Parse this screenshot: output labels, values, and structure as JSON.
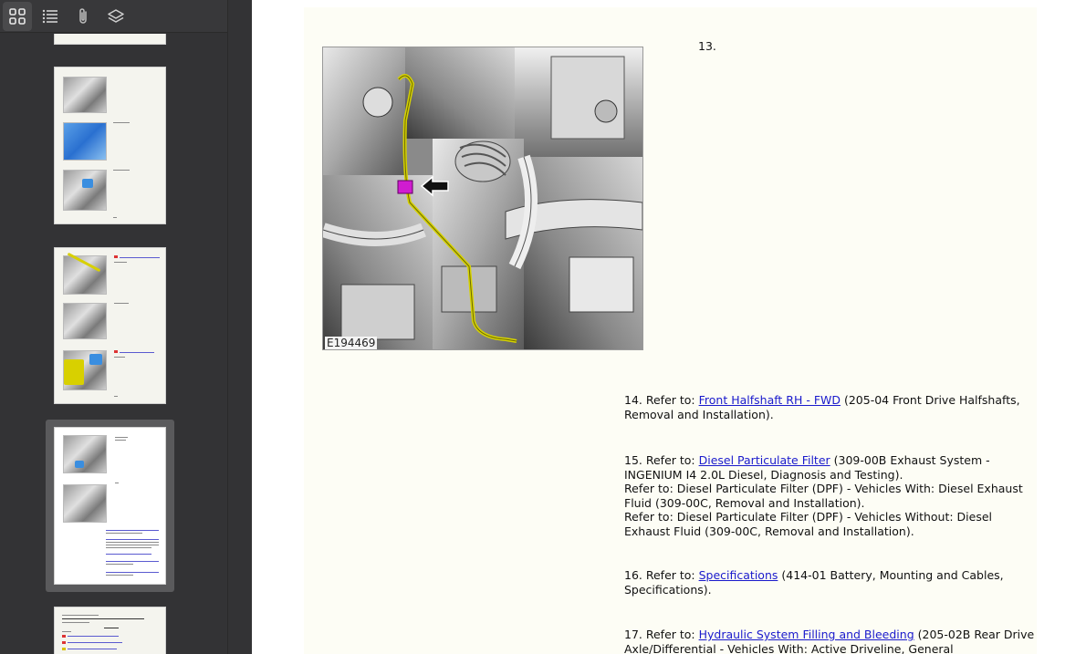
{
  "toolbar": {
    "thumbnails_icon": "grid-icon",
    "outline_icon": "list-icon",
    "attachments_icon": "paperclip-icon",
    "layers_icon": "layers-icon"
  },
  "figure": {
    "label": "E194469"
  },
  "steps": {
    "s13": {
      "num": "13."
    },
    "s14": {
      "prefix": "14. Refer to: ",
      "link": "Front Halfshaft RH - FWD",
      "rest": " (205-04 Front Drive Halfshafts, Removal and Installation)."
    },
    "s15": {
      "prefix": "15. Refer to: ",
      "link": "Diesel Particulate Filter",
      "rest": " (309-00B Exhaust System - INGENIUM I4 2.0L Diesel, Diagnosis and Testing).",
      "line2": "Refer to: Diesel Particulate Filter (DPF) - Vehicles With: Diesel Exhaust Fluid (309-00C, Removal and Installation).",
      "line3": "Refer to: Diesel Particulate Filter (DPF) - Vehicles Without: Diesel Exhaust Fluid (309-00C, Removal and Installation)."
    },
    "s16": {
      "prefix": "16. Refer to: ",
      "link": "Specifications",
      "rest": " (414-01 Battery, Mounting and Cables, Specifications)."
    },
    "s17": {
      "prefix": "17. Refer to: ",
      "link": "Hydraulic System Filling and Bleeding",
      "rest": " (205-02B Rear Drive Axle/Differential - Vehicles With: Active Driveline, General"
    }
  },
  "colors": {
    "link": "#1a1acc",
    "sidebar_bg": "#333335",
    "page_bg": "#fdfdf5"
  }
}
